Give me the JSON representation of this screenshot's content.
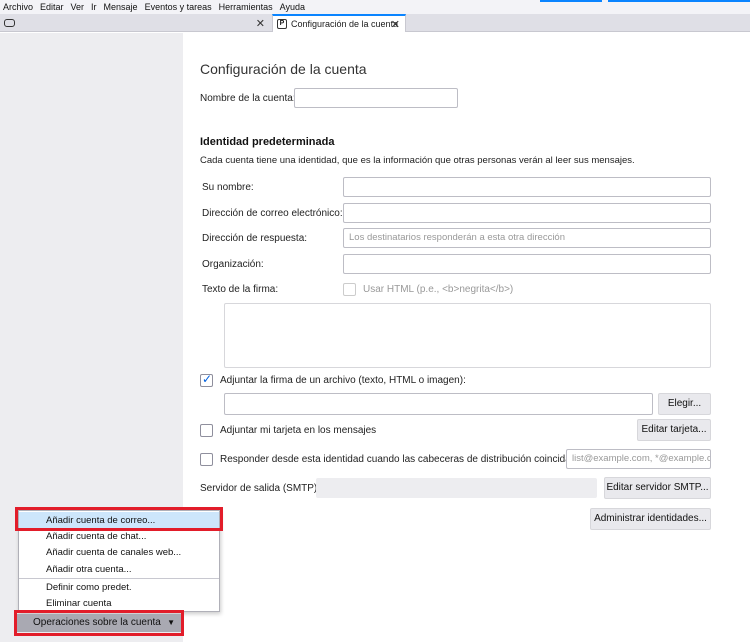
{
  "menubar": {
    "items": [
      "Archivo",
      "Editar",
      "Ver",
      "Ir",
      "Mensaje",
      "Eventos y tareas",
      "Herramientas",
      "Ayuda"
    ]
  },
  "tabs": {
    "active_label": "Configuración de la cuenta",
    "close_glyph": "✕"
  },
  "page": {
    "title": "Configuración de la cuenta",
    "account_name_label": "Nombre de la cuenta:",
    "account_name_value": ""
  },
  "identity": {
    "heading": "Identidad predeterminada",
    "description": "Cada cuenta tiene una identidad, que es la información que otras personas verán al leer sus mensajes.",
    "your_name_label": "Su nombre:",
    "email_label": "Dirección de correo electrónico:",
    "reply_to_label": "Dirección de respuesta:",
    "reply_to_placeholder": "Los destinatarios responderán a esta otra dirección",
    "organization_label": "Organización:",
    "signature_label": "Texto de la firma:",
    "use_html_label": "Usar HTML (p.e., <b>negrita</b>)",
    "attach_signature_label": "Adjuntar la firma de un archivo (texto, HTML o imagen):",
    "choose_button": "Elegir...",
    "attach_vcard_label": "Adjuntar mi tarjeta en los mensajes",
    "edit_card_button": "Editar tarjeta...",
    "reply_from_label": "Responder desde esta identidad cuando las cabeceras de distribución coincidan:",
    "reply_from_placeholder": "list@example.com, *@example.com",
    "smtp_label": "Servidor de salida (SMTP):",
    "edit_smtp_button": "Editar servidor SMTP...",
    "manage_identities_button": "Administrar identidades..."
  },
  "account_actions_menu": {
    "items": [
      "Añadir cuenta de correo...",
      "Añadir cuenta de chat...",
      "Añadir cuenta de canales web...",
      "Añadir otra cuenta...",
      "Definir como predet.",
      "Eliminar cuenta"
    ],
    "button_label": "Operaciones sobre la cuenta",
    "button_arrow": "▼"
  },
  "colors": {
    "accent": "#0a84ff",
    "highlight_box": "#e21d2a",
    "menu_hover": "#cde6fb"
  }
}
